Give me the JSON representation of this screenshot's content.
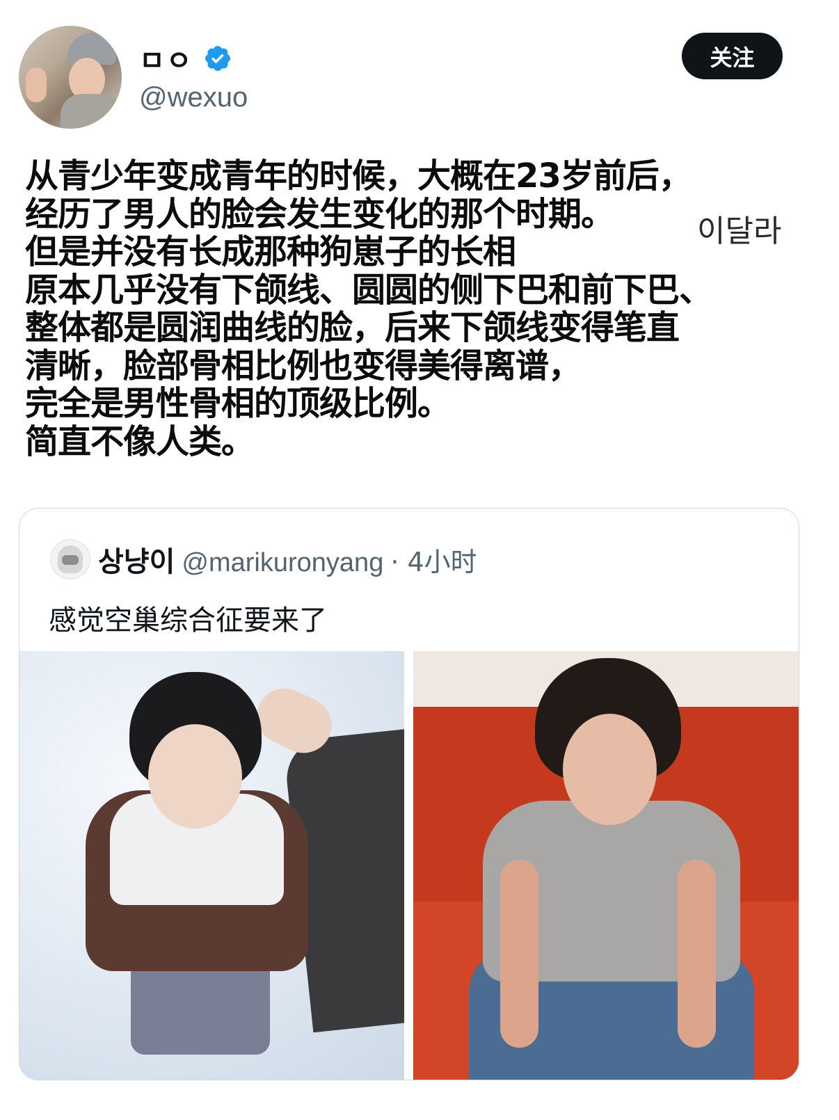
{
  "author": {
    "display_name": "ㅁㅇ",
    "handle": "@wexuo",
    "verified": true,
    "follow_label": "关注"
  },
  "tweet": {
    "lines": [
      "从青少年变成青年的时候，大概在23岁前后，",
      "经历了男人的脸会发生变化的那个时期。",
      "但是并没有长成那种狗崽子的长相",
      "原本几乎没有下颌线、圆圆的侧下巴和前下巴、",
      "整体都是圆润曲线的脸，后来下颌线变得笔直",
      "清晰，脸部骨相比例也变得美得离谱，",
      "完全是男性骨相的顶级比例。",
      "简直不像人类。"
    ],
    "overlay_korean": "이달라"
  },
  "quoted": {
    "display_name": "상냥이",
    "handle": "@marikuronyang",
    "time": "· 4小时",
    "text": "感觉空巢综合征要来了"
  },
  "colors": {
    "accent": "#1d9bf0",
    "text_primary": "#0f1419",
    "text_secondary": "#536471",
    "border": "#cfd9de"
  }
}
